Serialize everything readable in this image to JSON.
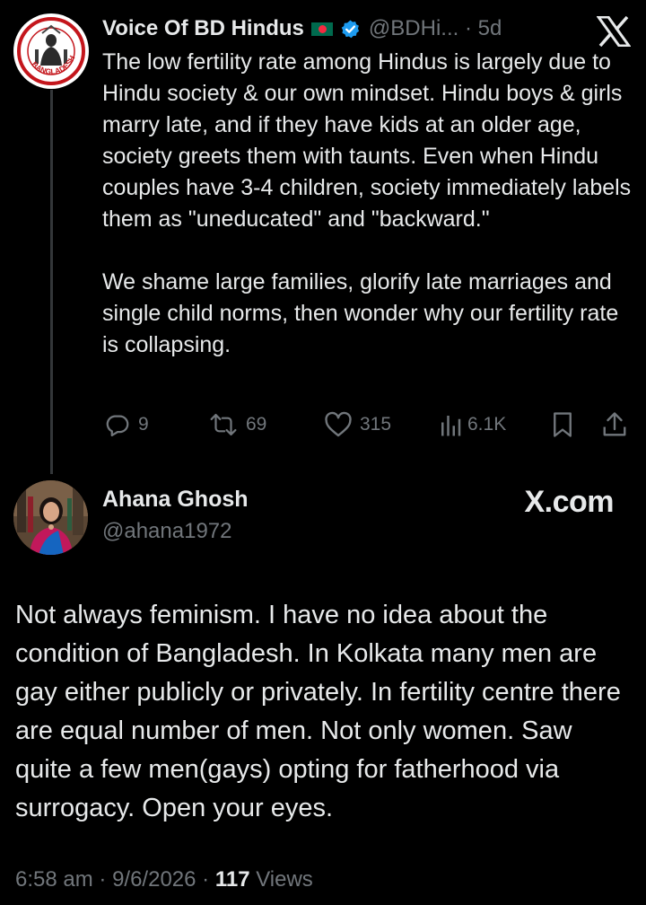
{
  "parent_tweet": {
    "author_name": "Voice Of BD Hindus",
    "author_handle": "@BDHi...",
    "separator": "·",
    "time_ago": "5d",
    "avatar_logo_text": "BANGLADESH",
    "flag_icon": "bangladesh-flag-icon",
    "verified_icon": "verified-badge-icon",
    "verified_color": "#1d9bf0",
    "platform_icon": "x-logo-icon",
    "text": "The low fertility rate among Hindus is largely due to Hindu society & our own mindset. Hindu boys & girls marry late, and if they have kids at an older age, society greets them with taunts. Even when Hindu couples have 3-4 children, society immediately labels them as \"uneducated\" and \"backward.\"\n\nWe shame large families, glorify late marriages and single child norms, then wonder why our fertility rate is collapsing.",
    "actions": {
      "replies": "9",
      "reposts": "69",
      "likes": "315",
      "views": "6.1K"
    }
  },
  "reply_tweet": {
    "author_name": "Ahana Ghosh",
    "author_handle": "@ahana1972",
    "watermark": "X.com",
    "text": "Not always feminism. I have no idea about the condition of Bangladesh. In Kolkata many men are gay either publicly or privately. In fertility centre there are equal number of men. Not only women. Saw quite a few men(gays) opting for fatherhood via surrogacy. Open your eyes.",
    "time": "6:58 am",
    "separator": "·",
    "date": "9/6/2026",
    "views_count": "117",
    "views_label": "Views"
  },
  "colors": {
    "background": "#000000",
    "text_primary": "#e7e9ea",
    "text_secondary": "#71767b",
    "thread_line": "#333639"
  }
}
